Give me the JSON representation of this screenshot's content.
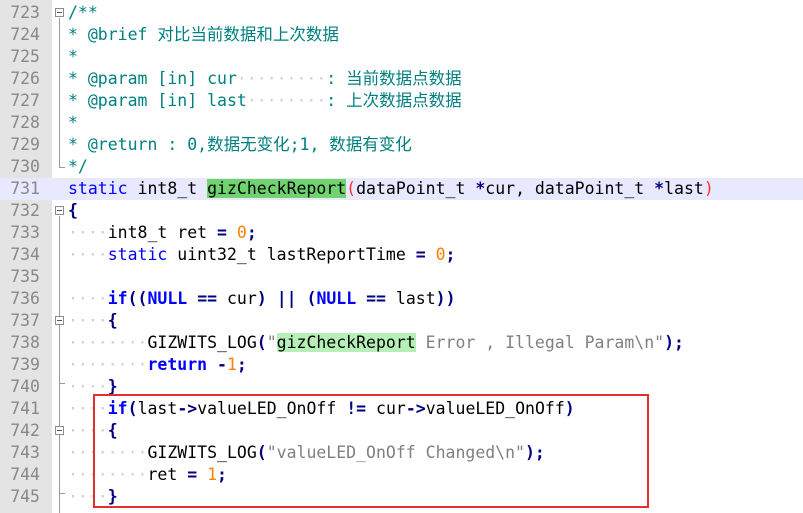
{
  "editor": {
    "lines": [
      {
        "no": "723",
        "parts": [
          {
            "c": "cm",
            "t": "/**"
          }
        ]
      },
      {
        "no": "724",
        "parts": [
          {
            "c": "cm",
            "t": "* @brief 对比当前数据和上次数据"
          }
        ]
      },
      {
        "no": "725",
        "parts": [
          {
            "c": "cm",
            "t": "*"
          }
        ]
      },
      {
        "no": "726",
        "parts": [
          {
            "c": "cm",
            "t": "* @param [in] cur"
          },
          {
            "c": "dot",
            "t": "·········"
          },
          {
            "c": "cm",
            "t": ": 当前数据点数据"
          }
        ]
      },
      {
        "no": "727",
        "parts": [
          {
            "c": "cm",
            "t": "* @param [in] last"
          },
          {
            "c": "dot",
            "t": "········"
          },
          {
            "c": "cm",
            "t": ": 上次数据点数据"
          }
        ]
      },
      {
        "no": "728",
        "parts": [
          {
            "c": "cm",
            "t": "*"
          }
        ]
      },
      {
        "no": "729",
        "parts": [
          {
            "c": "cm",
            "t": "* @return : 0,数据无变化;1, 数据有变化"
          }
        ]
      },
      {
        "no": "730",
        "parts": [
          {
            "c": "cm",
            "t": "*/"
          }
        ]
      },
      {
        "no": "731",
        "parts": [
          {
            "c": "kw",
            "t": "static"
          },
          {
            "c": "",
            "t": " int8_t "
          },
          {
            "c": "hl",
            "t": "gizCheckReport"
          },
          {
            "c": "paren",
            "t": "("
          },
          {
            "c": "",
            "t": "dataPoint_t "
          },
          {
            "c": "op",
            "t": "*"
          },
          {
            "c": "",
            "t": "cur, dataPoint_t "
          },
          {
            "c": "op",
            "t": "*"
          },
          {
            "c": "",
            "t": "last"
          },
          {
            "c": "paren",
            "t": ")"
          }
        ]
      },
      {
        "no": "732",
        "parts": [
          {
            "c": "op",
            "t": "{"
          }
        ]
      },
      {
        "no": "733",
        "parts": [
          {
            "c": "dot",
            "t": "····"
          },
          {
            "c": "",
            "t": "int8_t ret "
          },
          {
            "c": "op",
            "t": "="
          },
          {
            "c": "",
            "t": " "
          },
          {
            "c": "num",
            "t": "0"
          },
          {
            "c": "op",
            "t": ";"
          }
        ]
      },
      {
        "no": "734",
        "parts": [
          {
            "c": "dot",
            "t": "····"
          },
          {
            "c": "kw",
            "t": "static"
          },
          {
            "c": "",
            "t": " uint32_t lastReportTime "
          },
          {
            "c": "op",
            "t": "="
          },
          {
            "c": "",
            "t": " "
          },
          {
            "c": "num",
            "t": "0"
          },
          {
            "c": "op",
            "t": ";"
          }
        ]
      },
      {
        "no": "735",
        "parts": []
      },
      {
        "no": "736",
        "parts": [
          {
            "c": "dot",
            "t": "····"
          },
          {
            "c": "kwb",
            "t": "if"
          },
          {
            "c": "op",
            "t": "(("
          },
          {
            "c": "kwb",
            "t": "NULL"
          },
          {
            "c": "",
            "t": " "
          },
          {
            "c": "op",
            "t": "=="
          },
          {
            "c": "",
            "t": " cur"
          },
          {
            "c": "op",
            "t": ")"
          },
          {
            "c": "",
            "t": " "
          },
          {
            "c": "op",
            "t": "||"
          },
          {
            "c": "",
            "t": " "
          },
          {
            "c": "op",
            "t": "("
          },
          {
            "c": "kwb",
            "t": "NULL"
          },
          {
            "c": "",
            "t": " "
          },
          {
            "c": "op",
            "t": "=="
          },
          {
            "c": "",
            "t": " last"
          },
          {
            "c": "op",
            "t": "))"
          }
        ]
      },
      {
        "no": "737",
        "parts": [
          {
            "c": "dot",
            "t": "····"
          },
          {
            "c": "op",
            "t": "{"
          }
        ]
      },
      {
        "no": "738",
        "parts": [
          {
            "c": "dot",
            "t": "········"
          },
          {
            "c": "",
            "t": "GIZWITS_LOG"
          },
          {
            "c": "op",
            "t": "("
          },
          {
            "c": "str",
            "t": "\""
          },
          {
            "c": "hlstr",
            "t": "gizCheckReport"
          },
          {
            "c": "str",
            "t": " Error , Illegal Param\\n\""
          },
          {
            "c": "op",
            "t": ");"
          }
        ]
      },
      {
        "no": "739",
        "parts": [
          {
            "c": "dot",
            "t": "········"
          },
          {
            "c": "kwb",
            "t": "return"
          },
          {
            "c": "",
            "t": " "
          },
          {
            "c": "op",
            "t": "-"
          },
          {
            "c": "num",
            "t": "1"
          },
          {
            "c": "op",
            "t": ";"
          }
        ]
      },
      {
        "no": "740",
        "parts": [
          {
            "c": "dot",
            "t": "····"
          },
          {
            "c": "op",
            "t": "}"
          }
        ]
      },
      {
        "no": "741",
        "parts": [
          {
            "c": "dot",
            "t": "····"
          },
          {
            "c": "kwb",
            "t": "if"
          },
          {
            "c": "op",
            "t": "("
          },
          {
            "c": "",
            "t": "last"
          },
          {
            "c": "op",
            "t": "->"
          },
          {
            "c": "",
            "t": "valueLED_OnOff "
          },
          {
            "c": "op",
            "t": "!="
          },
          {
            "c": "",
            "t": " cur"
          },
          {
            "c": "op",
            "t": "->"
          },
          {
            "c": "",
            "t": "valueLED_OnOff"
          },
          {
            "c": "op",
            "t": ")"
          }
        ]
      },
      {
        "no": "742",
        "parts": [
          {
            "c": "dot",
            "t": "····"
          },
          {
            "c": "op",
            "t": "{"
          }
        ]
      },
      {
        "no": "743",
        "parts": [
          {
            "c": "dot",
            "t": "········"
          },
          {
            "c": "",
            "t": "GIZWITS_LOG"
          },
          {
            "c": "op",
            "t": "("
          },
          {
            "c": "str",
            "t": "\"valueLED_OnOff Changed\\n\""
          },
          {
            "c": "op",
            "t": ");"
          }
        ]
      },
      {
        "no": "744",
        "parts": [
          {
            "c": "dot",
            "t": "········"
          },
          {
            "c": "",
            "t": "ret "
          },
          {
            "c": "op",
            "t": "="
          },
          {
            "c": "",
            "t": " "
          },
          {
            "c": "num",
            "t": "1"
          },
          {
            "c": "op",
            "t": ";"
          }
        ]
      },
      {
        "no": "745",
        "parts": [
          {
            "c": "dot",
            "t": "····"
          },
          {
            "c": "op",
            "t": "}"
          }
        ]
      }
    ],
    "current_line": "731",
    "highlight_box_label": "highlighted-if-block"
  }
}
